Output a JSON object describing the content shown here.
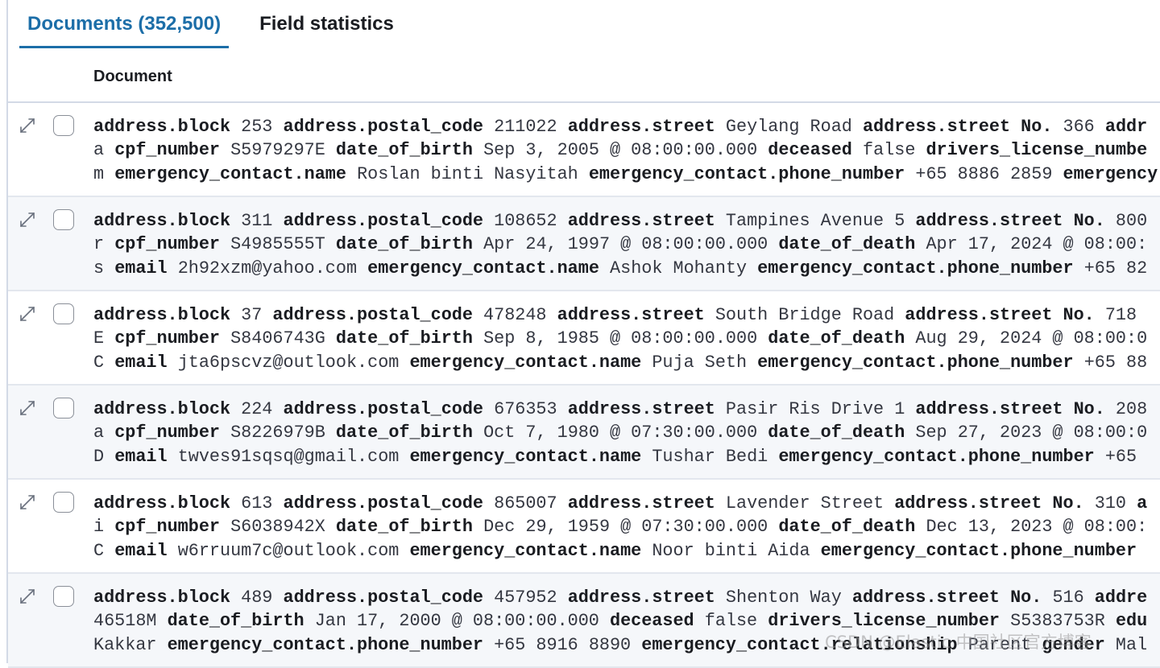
{
  "tabs": [
    {
      "label": "Documents (352,500)",
      "active": true
    },
    {
      "label": "Field statistics",
      "active": false
    }
  ],
  "column_header": "Document",
  "rows": [
    {
      "lines": [
        [
          [
            "k",
            "address.block"
          ],
          [
            "v",
            "253"
          ],
          [
            "k",
            "address.postal_code"
          ],
          [
            "v",
            "211022"
          ],
          [
            "k",
            "address.street"
          ],
          [
            "v",
            "Geylang Road"
          ],
          [
            "k",
            "address.street No."
          ],
          [
            "v",
            "366"
          ],
          [
            "k",
            "addr"
          ]
        ],
        [
          [
            "v",
            "a"
          ],
          [
            "k",
            "cpf_number"
          ],
          [
            "v",
            "S5979297E"
          ],
          [
            "k",
            "date_of_birth"
          ],
          [
            "v",
            "Sep 3, 2005 @ 08:00:00.000"
          ],
          [
            "k",
            "deceased"
          ],
          [
            "v",
            "false"
          ],
          [
            "k",
            "drivers_license_numbe"
          ]
        ],
        [
          [
            "v",
            "m"
          ],
          [
            "k",
            "emergency_contact.name"
          ],
          [
            "v",
            "Roslan binti Nasyitah"
          ],
          [
            "k",
            "emergency_contact.phone_number"
          ],
          [
            "v",
            "+65 8886 2859"
          ],
          [
            "k",
            "emergency"
          ]
        ]
      ]
    },
    {
      "lines": [
        [
          [
            "k",
            "address.block"
          ],
          [
            "v",
            "311"
          ],
          [
            "k",
            "address.postal_code"
          ],
          [
            "v",
            "108652"
          ],
          [
            "k",
            "address.street"
          ],
          [
            "v",
            "Tampines Avenue 5"
          ],
          [
            "k",
            "address.street No."
          ],
          [
            "v",
            "800"
          ]
        ],
        [
          [
            "v",
            "r"
          ],
          [
            "k",
            "cpf_number"
          ],
          [
            "v",
            "S4985555T"
          ],
          [
            "k",
            "date_of_birth"
          ],
          [
            "v",
            "Apr 24, 1997 @ 08:00:00.000"
          ],
          [
            "k",
            "date_of_death"
          ],
          [
            "v",
            "Apr 17, 2024 @ 08:00:"
          ]
        ],
        [
          [
            "v",
            "s"
          ],
          [
            "k",
            "email"
          ],
          [
            "v",
            "2h92xzm@yahoo.com"
          ],
          [
            "k",
            "emergency_contact.name"
          ],
          [
            "v",
            "Ashok Mohanty"
          ],
          [
            "k",
            "emergency_contact.phone_number"
          ],
          [
            "v",
            "+65 82"
          ]
        ]
      ]
    },
    {
      "lines": [
        [
          [
            "k",
            "address.block"
          ],
          [
            "v",
            "37"
          ],
          [
            "k",
            "address.postal_code"
          ],
          [
            "v",
            "478248"
          ],
          [
            "k",
            "address.street"
          ],
          [
            "v",
            "South Bridge Road"
          ],
          [
            "k",
            "address.street No."
          ],
          [
            "v",
            "718"
          ]
        ],
        [
          [
            "v",
            "E"
          ],
          [
            "k",
            "cpf_number"
          ],
          [
            "v",
            "S8406743G"
          ],
          [
            "k",
            "date_of_birth"
          ],
          [
            "v",
            "Sep 8, 1985 @ 08:00:00.000"
          ],
          [
            "k",
            "date_of_death"
          ],
          [
            "v",
            "Aug 29, 2024 @ 08:00:0"
          ]
        ],
        [
          [
            "v",
            "C"
          ],
          [
            "k",
            "email"
          ],
          [
            "v",
            "jta6pscvz@outlook.com"
          ],
          [
            "k",
            "emergency_contact.name"
          ],
          [
            "v",
            "Puja Seth"
          ],
          [
            "k",
            "emergency_contact.phone_number"
          ],
          [
            "v",
            "+65 88"
          ]
        ]
      ]
    },
    {
      "lines": [
        [
          [
            "k",
            "address.block"
          ],
          [
            "v",
            "224"
          ],
          [
            "k",
            "address.postal_code"
          ],
          [
            "v",
            "676353"
          ],
          [
            "k",
            "address.street"
          ],
          [
            "v",
            "Pasir Ris Drive 1"
          ],
          [
            "k",
            "address.street No."
          ],
          [
            "v",
            "208"
          ]
        ],
        [
          [
            "v",
            "a"
          ],
          [
            "k",
            "cpf_number"
          ],
          [
            "v",
            "S8226979B"
          ],
          [
            "k",
            "date_of_birth"
          ],
          [
            "v",
            "Oct 7, 1980 @ 07:30:00.000"
          ],
          [
            "k",
            "date_of_death"
          ],
          [
            "v",
            "Sep 27, 2023 @ 08:00:0"
          ]
        ],
        [
          [
            "v",
            "D"
          ],
          [
            "k",
            "email"
          ],
          [
            "v",
            "twves91sqsq@gmail.com"
          ],
          [
            "k",
            "emergency_contact.name"
          ],
          [
            "v",
            "Tushar Bedi"
          ],
          [
            "k",
            "emergency_contact.phone_number"
          ],
          [
            "v",
            "+65"
          ]
        ]
      ]
    },
    {
      "lines": [
        [
          [
            "k",
            "address.block"
          ],
          [
            "v",
            "613"
          ],
          [
            "k",
            "address.postal_code"
          ],
          [
            "v",
            "865007"
          ],
          [
            "k",
            "address.street"
          ],
          [
            "v",
            "Lavender Street"
          ],
          [
            "k",
            "address.street No."
          ],
          [
            "v",
            "310"
          ],
          [
            "k",
            "a"
          ]
        ],
        [
          [
            "v",
            "i"
          ],
          [
            "k",
            "cpf_number"
          ],
          [
            "v",
            "S6038942X"
          ],
          [
            "k",
            "date_of_birth"
          ],
          [
            "v",
            "Dec 29, 1959 @ 07:30:00.000"
          ],
          [
            "k",
            "date_of_death"
          ],
          [
            "v",
            "Dec 13, 2023 @ 08:00:"
          ]
        ],
        [
          [
            "v",
            "C"
          ],
          [
            "k",
            "email"
          ],
          [
            "v",
            "w6rruum7c@outlook.com"
          ],
          [
            "k",
            "emergency_contact.name"
          ],
          [
            "v",
            "Noor binti Aida"
          ],
          [
            "k",
            "emergency_contact.phone_number"
          ]
        ]
      ]
    },
    {
      "lines": [
        [
          [
            "k",
            "address.block"
          ],
          [
            "v",
            "489"
          ],
          [
            "k",
            "address.postal_code"
          ],
          [
            "v",
            "457952"
          ],
          [
            "k",
            "address.street"
          ],
          [
            "v",
            "Shenton Way"
          ],
          [
            "k",
            "address.street No."
          ],
          [
            "v",
            "516"
          ],
          [
            "k",
            "addre"
          ]
        ],
        [
          [
            "v",
            "46518M"
          ],
          [
            "k",
            "date_of_birth"
          ],
          [
            "v",
            "Jan 17, 2000 @ 08:00:00.000"
          ],
          [
            "k",
            "deceased"
          ],
          [
            "v",
            "false"
          ],
          [
            "k",
            "drivers_license_number"
          ],
          [
            "v",
            "S5383753R"
          ],
          [
            "k",
            "edu"
          ]
        ],
        [
          [
            "v",
            "Kakkar"
          ],
          [
            "k",
            "emergency_contact.phone_number"
          ],
          [
            "v",
            "+65 8916 8890"
          ],
          [
            "k",
            "emergency_contact.relationship"
          ],
          [
            "v",
            "Parent"
          ],
          [
            "k",
            "gender"
          ],
          [
            "v",
            "Mal"
          ]
        ]
      ]
    }
  ],
  "watermark": "CSDN @Elastic 中国社区官方博客",
  "colors": {
    "accent": "#1c6ea8",
    "row_stripe": "#f5f7fa",
    "border": "#d3dae6"
  }
}
